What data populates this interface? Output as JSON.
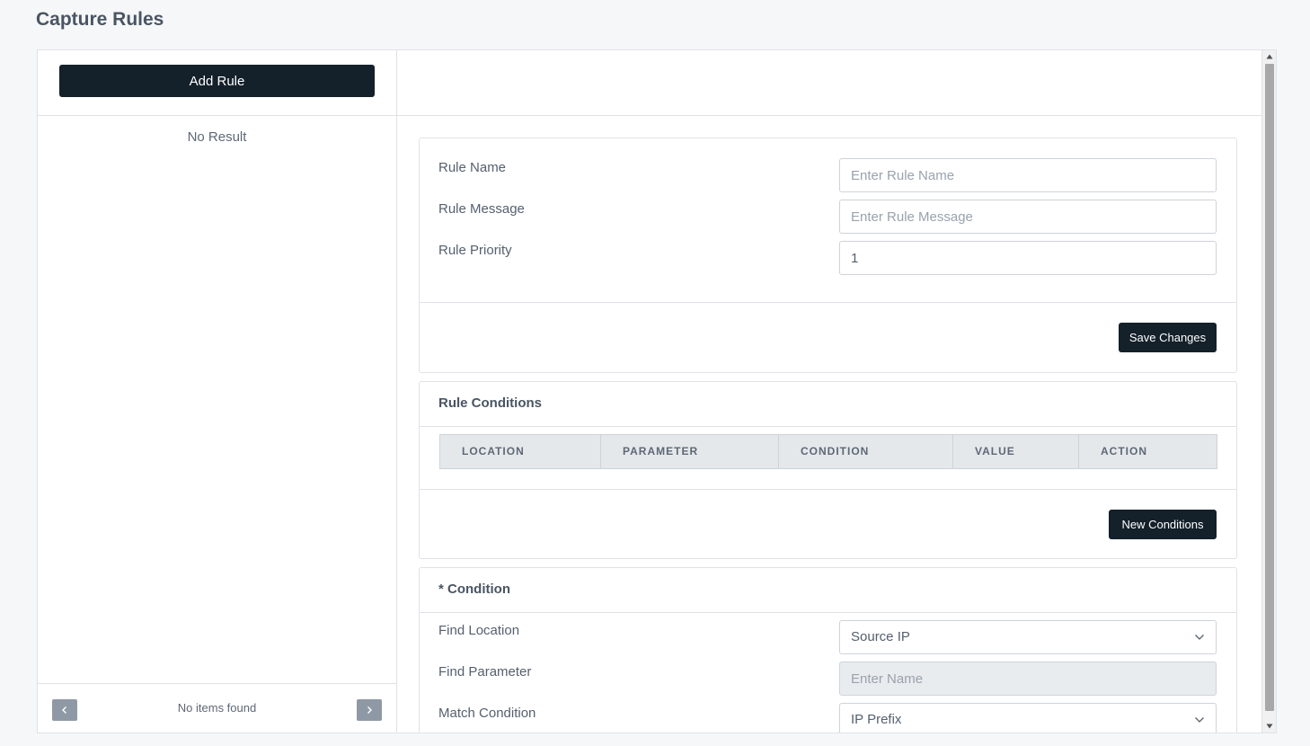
{
  "page": {
    "title": "Capture Rules"
  },
  "left_panel": {
    "add_rule_label": "Add Rule",
    "empty_text": "No Result",
    "pagination": {
      "status_text": "No items found",
      "prev_icon": "chevron-left-icon",
      "next_icon": "chevron-right-icon"
    }
  },
  "rule_form": {
    "name": {
      "label": "Rule Name",
      "value": "",
      "placeholder": "Enter Rule Name"
    },
    "message": {
      "label": "Rule Message",
      "value": "",
      "placeholder": "Enter Rule Message"
    },
    "priority": {
      "label": "Rule Priority",
      "value": "1",
      "placeholder": ""
    },
    "save_label": "Save Changes"
  },
  "rule_conditions": {
    "title": "Rule Conditions",
    "columns": [
      "LOCATION",
      "PARAMETER",
      "CONDITION",
      "VALUE",
      "ACTION"
    ],
    "rows": [],
    "new_label": "New Conditions"
  },
  "condition_form": {
    "title": "* Condition",
    "find_location": {
      "label": "Find Location",
      "selected": "Source IP"
    },
    "find_parameter": {
      "label": "Find Parameter",
      "value": "",
      "placeholder": "Enter Name",
      "disabled": true
    },
    "match_condition": {
      "label": "Match Condition",
      "selected": "IP Prefix"
    }
  },
  "theme": {
    "primary_button": "#14202a",
    "pager_button": "#8f99a6",
    "table_header_bg": "#e5e8eb"
  }
}
